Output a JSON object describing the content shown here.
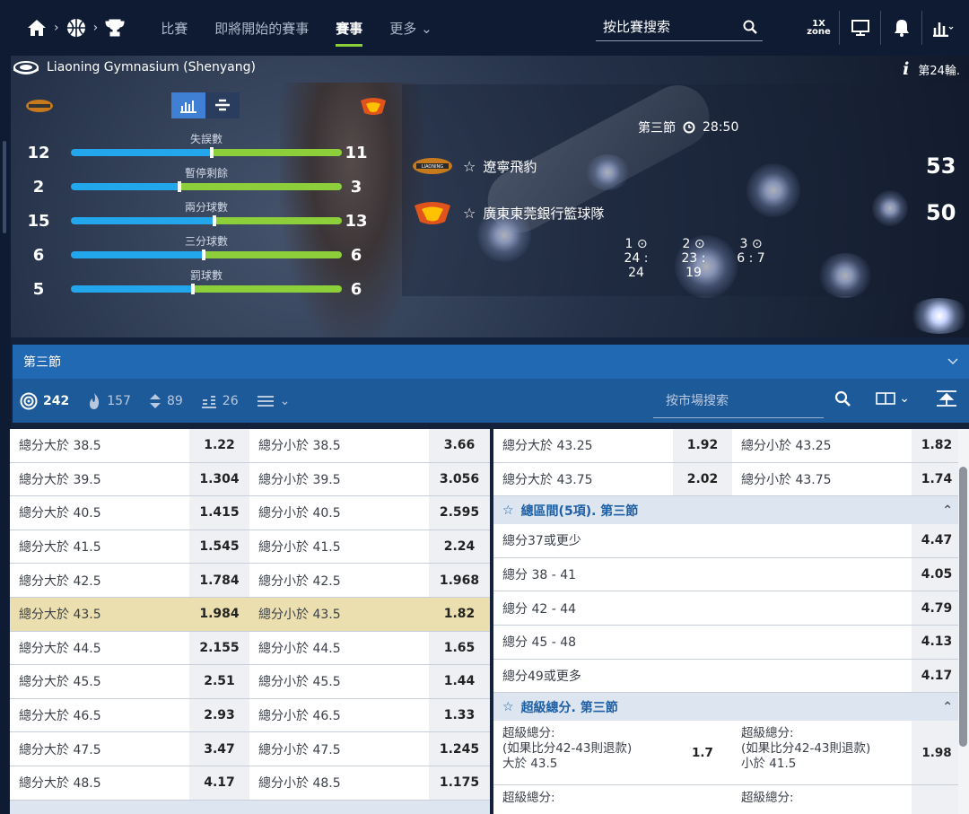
{
  "nav": {
    "links": [
      "比賽",
      "即將開始的賽事",
      "賽事",
      "更多"
    ],
    "search_placeholder": "按比賽搜索",
    "zone_top": "1X",
    "zone_bottom": "zone",
    "icons": [
      "home-icon",
      "basketball-icon",
      "trophy-icon",
      "search-icon",
      "monitor-icon",
      "bell-icon",
      "stats-icon"
    ]
  },
  "hero": {
    "stadium": "Liaoning Gymnasium (Shenyang)",
    "round": "第24輪.",
    "stats": [
      {
        "label": "失誤數",
        "left": "12",
        "right": "11",
        "left_share": 0.52
      },
      {
        "label": "暫停剩餘",
        "left": "2",
        "right": "3",
        "left_share": 0.4
      },
      {
        "label": "兩分球數",
        "left": "15",
        "right": "13",
        "left_share": 0.53
      },
      {
        "label": "三分球數",
        "left": "6",
        "right": "6",
        "left_share": 0.49
      },
      {
        "label": "罰球數",
        "left": "5",
        "right": "6",
        "left_share": 0.45
      }
    ],
    "period": "第三節",
    "clock": "28:50",
    "team1": {
      "name": "遼寧飛豹",
      "score": "53"
    },
    "team2": {
      "name": "廣東東莞銀行籃球隊",
      "score": "50"
    },
    "quarters": [
      {
        "num": "1",
        "score": "24 : 24"
      },
      {
        "num": "2",
        "score": "23 : 19"
      },
      {
        "num": "3",
        "score": "6 : 7"
      }
    ]
  },
  "section": {
    "title": "第三節"
  },
  "tabs": {
    "items": [
      {
        "icon": "target-icon",
        "count": "242"
      },
      {
        "icon": "fire-icon",
        "count": "157"
      },
      {
        "icon": "updown-icon",
        "count": "89"
      },
      {
        "icon": "bars-icon",
        "count": "26"
      }
    ],
    "search_placeholder": "按市場搜索"
  },
  "left_rows": [
    {
      "over": "總分大於 38.5",
      "over_odds": "1.22",
      "under": "總分小於 38.5",
      "under_odds": "3.66"
    },
    {
      "over": "總分大於 39.5",
      "over_odds": "1.304",
      "under": "總分小於 39.5",
      "under_odds": "3.056"
    },
    {
      "over": "總分大於 40.5",
      "over_odds": "1.415",
      "under": "總分小於 40.5",
      "under_odds": "2.595"
    },
    {
      "over": "總分大於 41.5",
      "over_odds": "1.545",
      "under": "總分小於 41.5",
      "under_odds": "2.24"
    },
    {
      "over": "總分大於 42.5",
      "over_odds": "1.784",
      "under": "總分小於 42.5",
      "under_odds": "1.968"
    },
    {
      "over": "總分大於 43.5",
      "over_odds": "1.984",
      "under": "總分小於 43.5",
      "under_odds": "1.82"
    },
    {
      "over": "總分大於 44.5",
      "over_odds": "2.155",
      "under": "總分小於 44.5",
      "under_odds": "1.65"
    },
    {
      "over": "總分大於 45.5",
      "over_odds": "2.51",
      "under": "總分小於 45.5",
      "under_odds": "1.44"
    },
    {
      "over": "總分大於 46.5",
      "over_odds": "2.93",
      "under": "總分小於 46.5",
      "under_odds": "1.33"
    },
    {
      "over": "總分大於 47.5",
      "over_odds": "3.47",
      "under": "總分小於 47.5",
      "under_odds": "1.245"
    },
    {
      "over": "總分大於 48.5",
      "over_odds": "4.17",
      "under": "總分小於 48.5",
      "under_odds": "1.175"
    }
  ],
  "right": {
    "rows": [
      {
        "over": "總分大於 43.25",
        "over_odds": "1.92",
        "under": "總分小於 43.25",
        "under_odds": "1.82"
      },
      {
        "over": "總分大於 43.75",
        "over_odds": "2.02",
        "under": "總分小於 43.75",
        "under_odds": "1.74"
      }
    ],
    "group1": {
      "title": "總區間(5項). 第三節",
      "rows": [
        {
          "label": "總分37或更少",
          "odds": "4.47"
        },
        {
          "label": "總分 38 - 41",
          "odds": "4.05"
        },
        {
          "label": "總分 42 - 44",
          "odds": "4.79"
        },
        {
          "label": "總分 45 - 48",
          "odds": "4.13"
        },
        {
          "label": "總分49或更多",
          "odds": "4.17"
        }
      ]
    },
    "group2": {
      "title": "超級總分. 第三節",
      "row": {
        "left_l1": "超級總分:",
        "left_l2": "(如果比分42-43則退款)",
        "left_l3": "大於 43.5",
        "left_odds": "1.7",
        "right_l1": "超級總分:",
        "right_l2": "(如果比分42-43則退款)",
        "right_l3": "小於 41.5",
        "right_odds": "1.98"
      },
      "next_left": "超級總分:",
      "next_right": "超級總分:"
    }
  },
  "colors": {
    "nav_bg": "#0f1b33",
    "accent_green": "#8ccf3a",
    "accent_blue": "#22a7ec",
    "section_blue": "#2169b3",
    "highlight": "#ecdfaf"
  }
}
